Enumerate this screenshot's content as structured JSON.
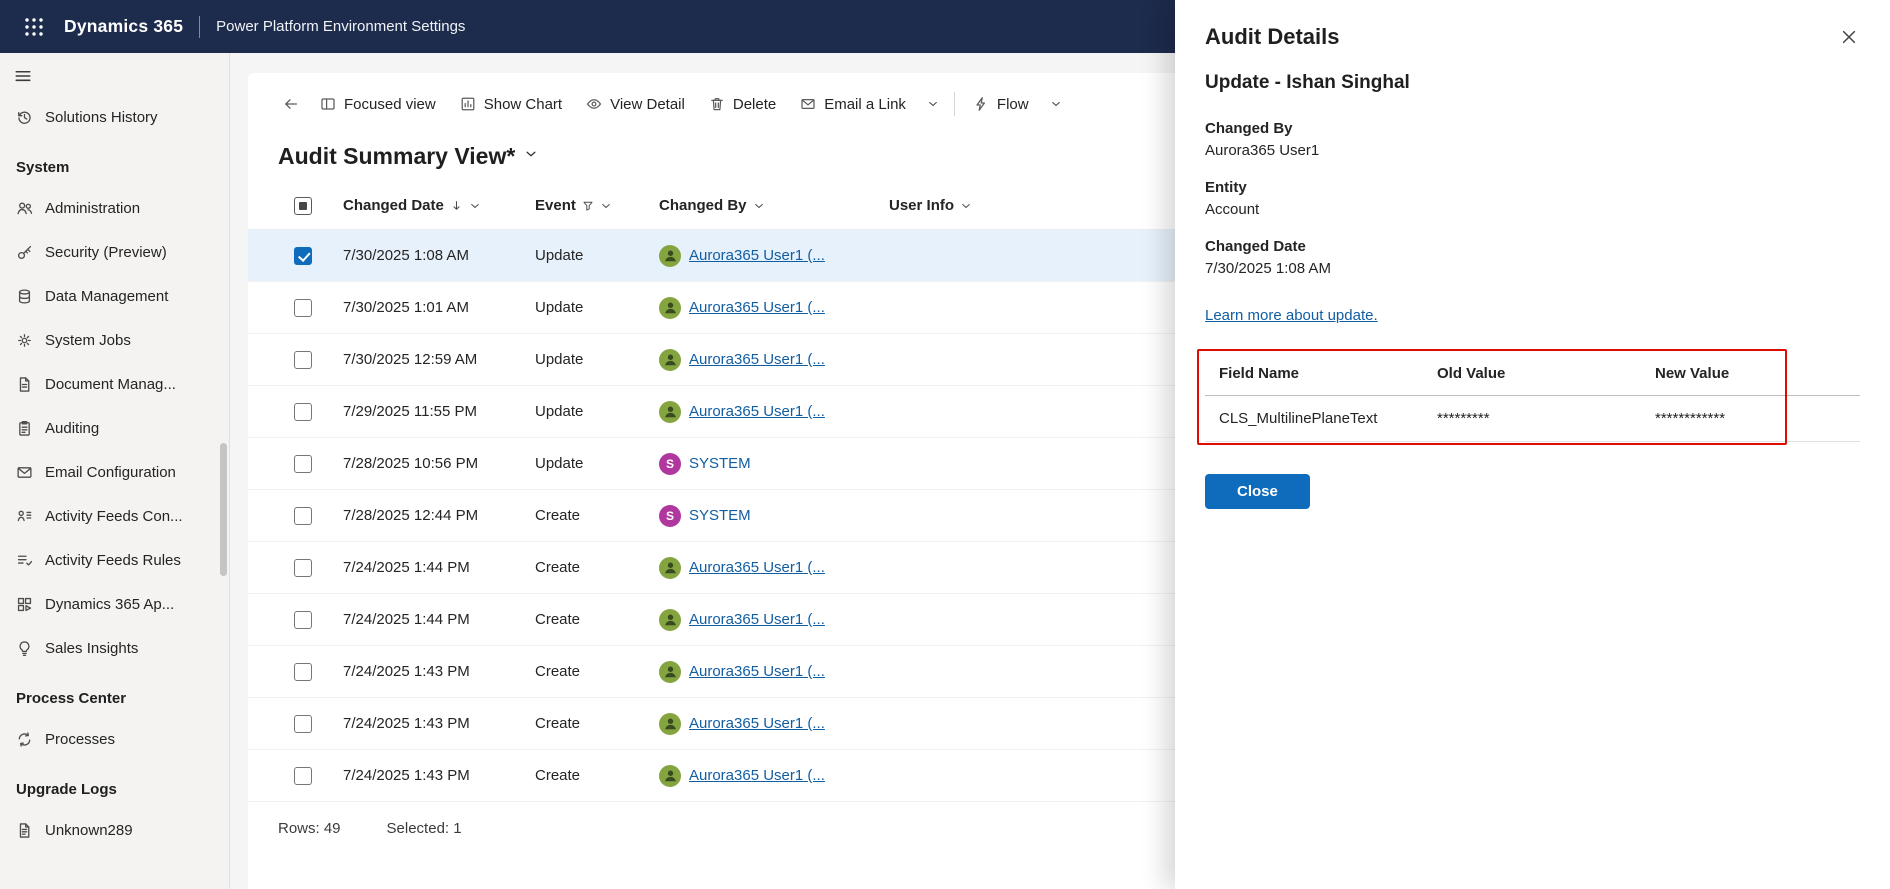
{
  "topbar": {
    "brand": "Dynamics 365",
    "subtitle": "Power Platform Environment Settings"
  },
  "sidebar": {
    "top_item": {
      "label": "Solutions History",
      "icon": "history-icon"
    },
    "sections": [
      {
        "title": "System",
        "items": [
          {
            "label": "Administration",
            "icon": "people-icon"
          },
          {
            "label": "Security (Preview)",
            "icon": "key-icon"
          },
          {
            "label": "Data Management",
            "icon": "database-icon"
          },
          {
            "label": "System Jobs",
            "icon": "gear-icon"
          },
          {
            "label": "Document Manag...",
            "icon": "document-icon"
          },
          {
            "label": "Auditing",
            "icon": "clipboard-icon"
          },
          {
            "label": "Email Configuration",
            "icon": "email-icon"
          },
          {
            "label": "Activity Feeds Con...",
            "icon": "feeds-icon"
          },
          {
            "label": "Activity Feeds Rules",
            "icon": "rules-icon"
          },
          {
            "label": "Dynamics 365 Ap...",
            "icon": "apps-icon"
          },
          {
            "label": "Sales Insights",
            "icon": "bulb-icon"
          }
        ]
      },
      {
        "title": "Process Center",
        "items": [
          {
            "label": "Processes",
            "icon": "sync-icon"
          }
        ]
      },
      {
        "title": "Upgrade Logs",
        "items": [
          {
            "label": "Unknown289",
            "icon": "log-icon"
          }
        ]
      }
    ]
  },
  "toolbar": {
    "buttons": [
      {
        "label": "Focused view",
        "icon": "focused-view-icon"
      },
      {
        "label": "Show Chart",
        "icon": "show-chart-icon"
      },
      {
        "label": "View Detail",
        "icon": "eye-icon"
      },
      {
        "label": "Delete",
        "icon": "trash-icon"
      },
      {
        "label": "Email a Link",
        "icon": "email-icon"
      }
    ],
    "flow_label": "Flow"
  },
  "view": {
    "title": "Audit Summary View*"
  },
  "grid": {
    "columns": [
      "Changed Date",
      "Event",
      "Changed By",
      "User Info"
    ],
    "rows": [
      {
        "date": "7/30/2025 1:08 AM",
        "event": "Update",
        "by": "Aurora365 User1 (...",
        "by_type": "user",
        "selected": true
      },
      {
        "date": "7/30/2025 1:01 AM",
        "event": "Update",
        "by": "Aurora365 User1 (...",
        "by_type": "user",
        "selected": false
      },
      {
        "date": "7/30/2025 12:59 AM",
        "event": "Update",
        "by": "Aurora365 User1 (...",
        "by_type": "user",
        "selected": false
      },
      {
        "date": "7/29/2025 11:55 PM",
        "event": "Update",
        "by": "Aurora365 User1 (...",
        "by_type": "user",
        "selected": false
      },
      {
        "date": "7/28/2025 10:56 PM",
        "event": "Update",
        "by": "SYSTEM",
        "by_type": "system",
        "selected": false
      },
      {
        "date": "7/28/2025 12:44 PM",
        "event": "Create",
        "by": "SYSTEM",
        "by_type": "system",
        "selected": false
      },
      {
        "date": "7/24/2025 1:44 PM",
        "event": "Create",
        "by": "Aurora365 User1 (...",
        "by_type": "user",
        "selected": false
      },
      {
        "date": "7/24/2025 1:44 PM",
        "event": "Create",
        "by": "Aurora365 User1 (...",
        "by_type": "user",
        "selected": false
      },
      {
        "date": "7/24/2025 1:43 PM",
        "event": "Create",
        "by": "Aurora365 User1 (...",
        "by_type": "user",
        "selected": false
      },
      {
        "date": "7/24/2025 1:43 PM",
        "event": "Create",
        "by": "Aurora365 User1 (...",
        "by_type": "user",
        "selected": false
      },
      {
        "date": "7/24/2025 1:43 PM",
        "event": "Create",
        "by": "Aurora365 User1 (...",
        "by_type": "user",
        "selected": false
      }
    ],
    "footer": {
      "rows_label": "Rows: 49",
      "selected_label": "Selected: 1"
    }
  },
  "panel": {
    "title": "Audit Details",
    "heading": "Update - Ishan Singhal",
    "fields": [
      {
        "label": "Changed By",
        "value": "Aurora365 User1"
      },
      {
        "label": "Entity",
        "value": "Account"
      },
      {
        "label": "Changed Date",
        "value": "7/30/2025 1:08 AM"
      }
    ],
    "link": "Learn more about update.",
    "table": {
      "headers": [
        "Field Name",
        "Old Value",
        "New Value"
      ],
      "rows": [
        [
          "CLS_MultilinePlaneText",
          "*********",
          "************"
        ]
      ]
    },
    "close_label": "Close"
  },
  "colors": {
    "topbar_bg": "#1d2b4c",
    "accent_blue": "#0f6cbd",
    "link_blue": "#115ea3",
    "highlight_red": "#e00b00",
    "selected_row": "#e7f1fb",
    "avatar_green": "#84a43f",
    "avatar_person": "#394a1f",
    "avatar_purple": "#b0379e",
    "sidebar_bg": "#f4f3f2"
  }
}
